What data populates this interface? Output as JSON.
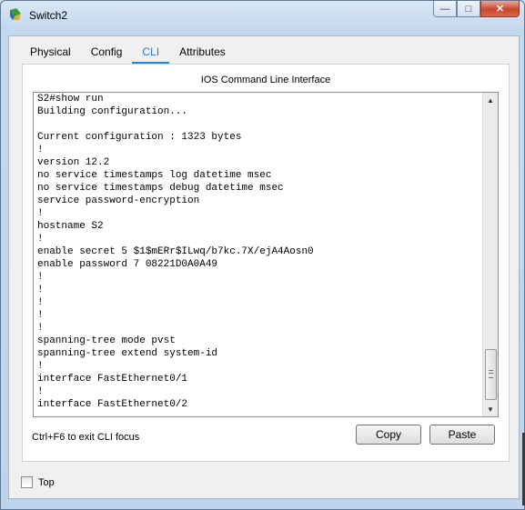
{
  "window": {
    "title": "Switch2",
    "min_glyph": "—",
    "max_glyph": "□",
    "close_glyph": "✕"
  },
  "tabs": [
    {
      "label": "Physical",
      "active": false
    },
    {
      "label": "Config",
      "active": false
    },
    {
      "label": "CLI",
      "active": true
    },
    {
      "label": "Attributes",
      "active": false
    }
  ],
  "panel": {
    "title": "IOS Command Line Interface"
  },
  "cli": {
    "lines": [
      "S2#show run",
      "Building configuration...",
      "",
      "Current configuration : 1323 bytes",
      "!",
      "version 12.2",
      "no service timestamps log datetime msec",
      "no service timestamps debug datetime msec",
      "service password-encryption",
      "!",
      "hostname S2",
      "!",
      "enable secret 5 $1$mERr$ILwq/b7kc.7X/ejA4Aosn0",
      "enable password 7 08221D0A0A49",
      "!",
      "!",
      "!",
      "!",
      "!",
      "spanning-tree mode pvst",
      "spanning-tree extend system-id",
      "!",
      "interface FastEthernet0/1",
      "!",
      "interface FastEthernet0/2"
    ],
    "scroll_up_glyph": "▲",
    "scroll_down_glyph": "▼"
  },
  "footer": {
    "hint": "Ctrl+F6 to exit CLI focus",
    "copy_label": "Copy",
    "paste_label": "Paste",
    "top_checkbox_label": "Top",
    "top_checked": false
  },
  "colors": {
    "active_tab": "#1d7ad8",
    "close_button": "#c7462e"
  },
  "icons": [
    "packet-tracer-app-icon",
    "minimize-icon",
    "maximize-icon",
    "close-icon",
    "scroll-up-icon",
    "scroll-down-icon"
  ]
}
